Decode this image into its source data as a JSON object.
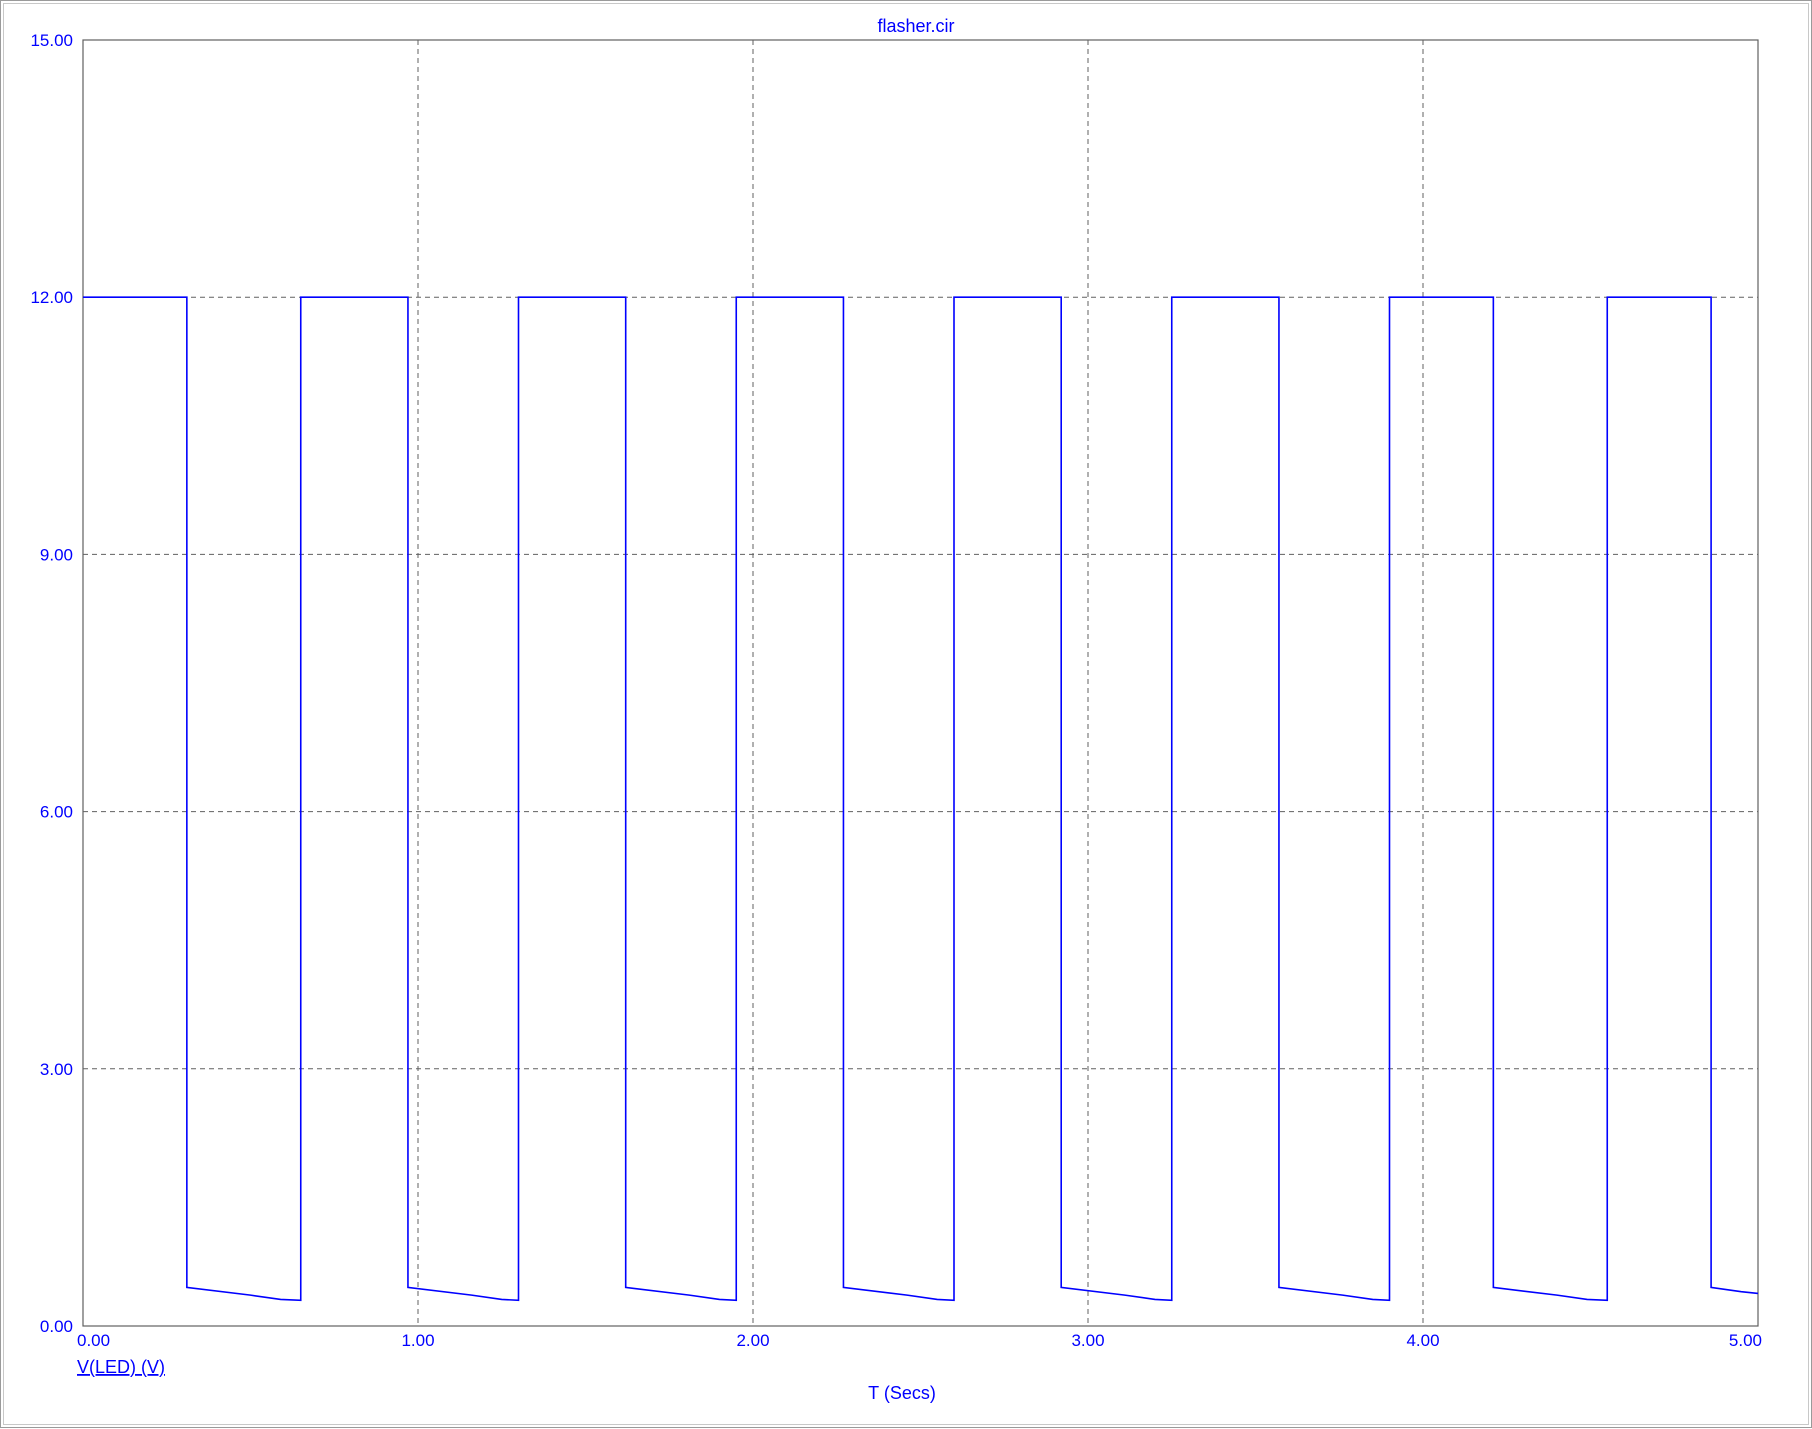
{
  "window": {
    "title": "flasher.cir"
  },
  "chart_data": {
    "type": "line",
    "title": "flasher.cir",
    "xlabel": "T (Secs)",
    "ylabel": "",
    "xlim": [
      0,
      5
    ],
    "ylim": [
      0,
      15
    ],
    "x_ticks": [
      "0.00",
      "1.00",
      "2.00",
      "3.00",
      "4.00",
      "5.00"
    ],
    "y_ticks": [
      "0.00",
      "3.00",
      "6.00",
      "9.00",
      "12.00",
      "15.00"
    ],
    "grid": true,
    "legend": "bottom-left",
    "colors": {
      "trace": "#0000ff",
      "text": "#0000ff",
      "grid": "#606060",
      "axes": "#606060"
    },
    "series": [
      {
        "name": "V(LED) (V)",
        "x": [
          0.0,
          0.31,
          0.31,
          0.5,
          0.59,
          0.65,
          0.65,
          0.97,
          0.97,
          1.16,
          1.25,
          1.3,
          1.3,
          1.62,
          1.62,
          1.81,
          1.9,
          1.95,
          1.95,
          2.27,
          2.27,
          2.46,
          2.55,
          2.6,
          2.6,
          2.92,
          2.92,
          3.11,
          3.2,
          3.25,
          3.25,
          3.57,
          3.57,
          3.76,
          3.85,
          3.9,
          3.9,
          4.21,
          4.21,
          4.4,
          4.49,
          4.55,
          4.55,
          4.86,
          4.86,
          4.95,
          5.0
        ],
        "y": [
          12.0,
          12.0,
          0.45,
          0.36,
          0.31,
          0.3,
          12.0,
          12.0,
          0.45,
          0.36,
          0.31,
          0.3,
          12.0,
          12.0,
          0.45,
          0.36,
          0.31,
          0.3,
          12.0,
          12.0,
          0.45,
          0.36,
          0.31,
          0.3,
          12.0,
          12.0,
          0.45,
          0.36,
          0.31,
          0.3,
          12.0,
          12.0,
          0.45,
          0.36,
          0.31,
          0.3,
          12.0,
          12.0,
          0.45,
          0.36,
          0.31,
          0.3,
          12.0,
          12.0,
          0.45,
          0.4,
          0.38
        ]
      }
    ]
  }
}
